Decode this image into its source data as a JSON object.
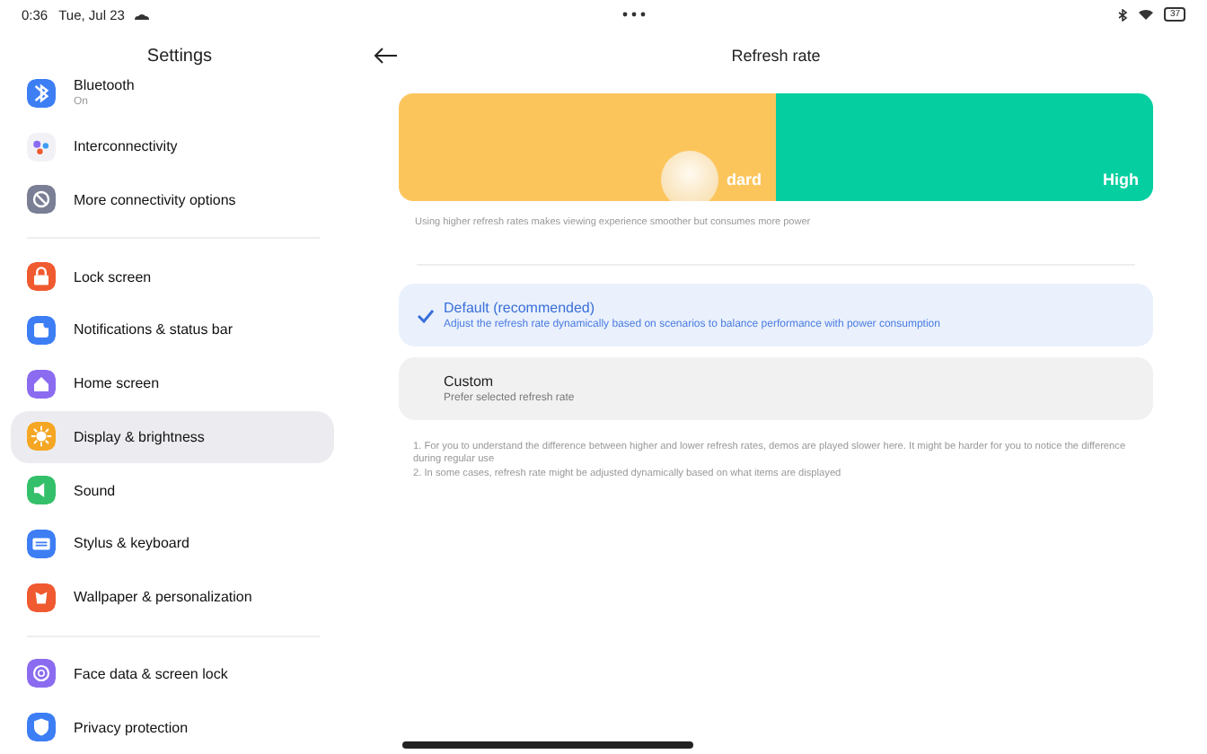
{
  "status_bar": {
    "time": "0:36",
    "date": "Tue, Jul 23",
    "battery": "37"
  },
  "sidebar": {
    "title": "Settings",
    "groups": [
      {
        "items": [
          {
            "label": "Bluetooth",
            "subtitle": "On",
            "color": "#3d7ef5",
            "selected": false
          },
          {
            "label": "Interconnectivity",
            "color": "#f2f2f6",
            "selected": false
          },
          {
            "label": "More connectivity options",
            "color": "#7a7f95",
            "selected": false
          }
        ]
      },
      {
        "items": [
          {
            "label": "Lock screen",
            "color": "#f05a30",
            "selected": false
          },
          {
            "label": "Notifications & status bar",
            "color": "#3d7ef5",
            "selected": false
          },
          {
            "label": "Home screen",
            "color": "#8b6cf0",
            "selected": false
          },
          {
            "label": "Display & brightness",
            "color": "#f5a623",
            "selected": true
          },
          {
            "label": "Sound",
            "color": "#34c06a",
            "selected": false
          },
          {
            "label": "Stylus & keyboard",
            "color": "#3d7ef5",
            "selected": false
          },
          {
            "label": "Wallpaper & personalization",
            "color": "#f05a30",
            "selected": false
          }
        ]
      },
      {
        "items": [
          {
            "label": "Face data & screen lock",
            "color": "#8b6cf0",
            "selected": false
          },
          {
            "label": "Privacy protection",
            "color": "#3d7ef5",
            "selected": false
          }
        ]
      }
    ]
  },
  "page": {
    "title": "Refresh rate",
    "preview": [
      {
        "label": "dard",
        "color": "#fcc55c"
      },
      {
        "label": "High",
        "color": "#05cfa0"
      }
    ],
    "caption": "Using higher refresh rates makes viewing experience smoother but consumes more power",
    "options": [
      {
        "title": "Default (recommended)",
        "description": "Adjust the refresh rate dynamically based on scenarios to balance performance with power consumption",
        "selected": true
      },
      {
        "title": "Custom",
        "description": "Prefer selected refresh rate",
        "selected": false
      }
    ],
    "notes": [
      "1. For you to understand the difference between higher and lower refresh rates, demos are played slower here. It might be harder for you to notice the difference during regular use",
      "2. In some cases, refresh rate might be adjusted dynamically based on what items are displayed"
    ]
  }
}
